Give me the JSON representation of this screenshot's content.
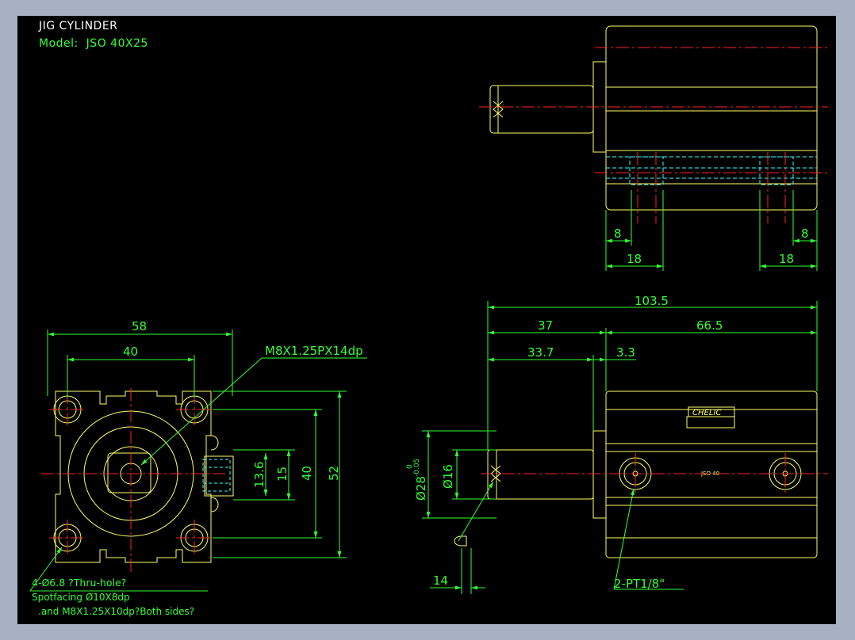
{
  "title": {
    "line1": "JIG CYLINDER",
    "model_label": "Model:",
    "model_value": "JSO 40X25"
  },
  "colors": {
    "background": "#000000",
    "frame": "#a7b1c1",
    "part_outline": "#ffff66",
    "dimension": "#33ff33",
    "centerline": "#ff2222",
    "hidden": "#33ffff",
    "title_text": "#ffffff"
  },
  "front_view": {
    "dims": {
      "width_outer": "58",
      "width_holes": "40",
      "height_outer": "52",
      "height_holes": "40",
      "port_15": "15",
      "port_13_6": "13.6"
    },
    "thread_callout": "M8X1.25PX14dp",
    "notes": {
      "line1": "4-Ø6.8 ?Thru-hole?",
      "line2": "Spotfacing Ø10X8dp",
      "line3": ".and M8X1.25X10dp?Both sides?"
    }
  },
  "side_view": {
    "dims": {
      "total_length": "103.5",
      "rod_section": "37",
      "body_length": "66.5",
      "rod_extension": "33.7",
      "flange": "3.3",
      "rod_dia": "Ø16",
      "bore_dia": "Ø28",
      "tol_upper": "0",
      "tol_lower": "-0.05",
      "rod_end": "14"
    },
    "label_brand": "CHELIC",
    "label_model": "JSO 40",
    "port_callout": "2-PT1/8\""
  },
  "top_view": {
    "dims": {
      "left_offset": "8",
      "left_span": "18",
      "right_offset": "8",
      "right_span": "18"
    }
  }
}
